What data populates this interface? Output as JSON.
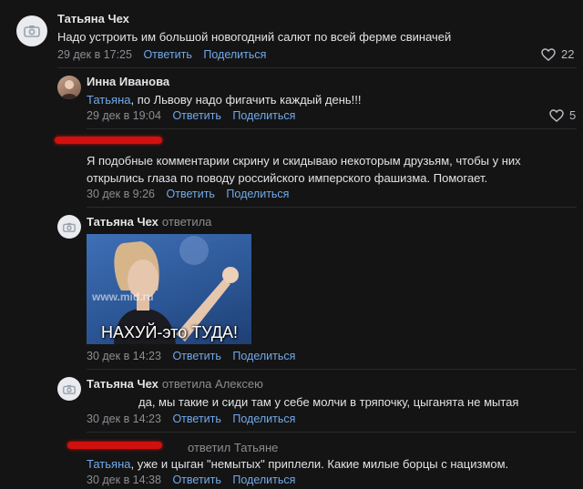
{
  "comments": [
    {
      "author": "Татьяна Чех",
      "text": "Надо устроить им большой новогодний салют по всей ферме свиначей",
      "time": "29 дек в 17:25",
      "likes": "22"
    },
    {
      "author": "Инна Иванова",
      "mention": "Татьяна",
      "text": ", по Львову надо фигачить каждый день!!!",
      "time": "29 дек в 19:04",
      "likes": "5"
    },
    {
      "text": "Я подобные комментарии скрину и скидываю некоторым друзьям, чтобы у них открылись глаза по поводу российского имперского фашизма. Помогает.",
      "time": "30 дек в 9:26"
    },
    {
      "author": "Татьяна Чех",
      "replied": "ответила",
      "image_caption": "НАХУЙ-это ТУДА!",
      "image_watermark": "www.mid.ru",
      "time": "30 дек в 14:23"
    },
    {
      "author": "Татьяна Чех",
      "replied": "ответила Алексею",
      "text": "да, мы такие и сиди там у себе молчи в тряпочку, цыганята не мытая",
      "time": "30 дек в 14:23"
    },
    {
      "replied": "ответил Татьяне",
      "mention": "Татьяна",
      "text": ", уже и цыган \"немытых\" приплели. Какие милые борцы с нацизмом.",
      "time": "30 дек в 14:38"
    }
  ],
  "actions": {
    "reply": "Ответить",
    "share": "Поделиться"
  },
  "icons": {
    "avatar_placeholder": "camera-icon",
    "like": "heart-outline-icon"
  },
  "colors": {
    "background": "#141414",
    "link": "#71aaeb",
    "secondary": "#8a8d92",
    "redaction": "#d11010"
  }
}
